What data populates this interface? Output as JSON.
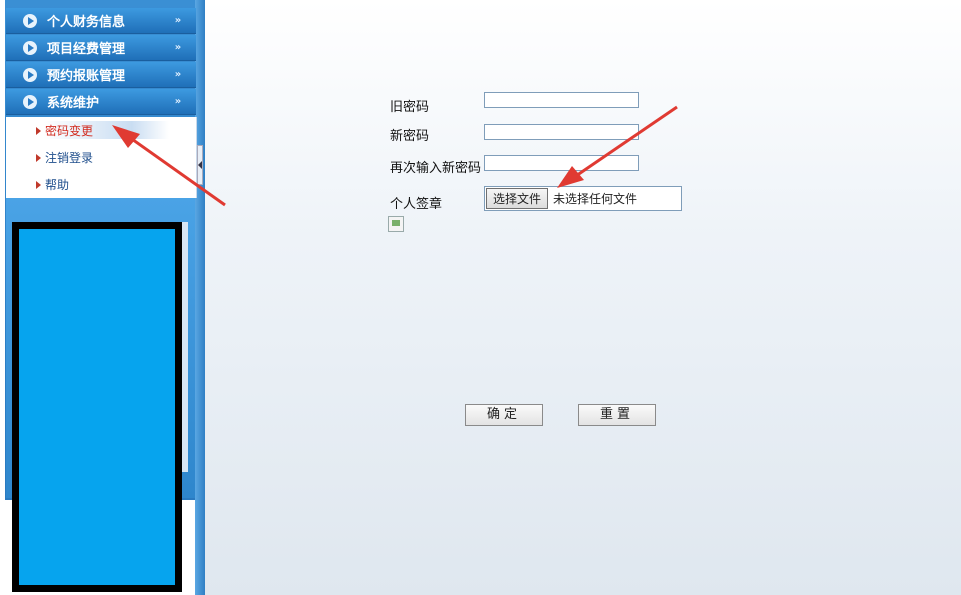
{
  "sidebar": {
    "menus": [
      {
        "label": "个人财务信息",
        "chevron": "»"
      },
      {
        "label": "项目经费管理",
        "chevron": "»"
      },
      {
        "label": "预约报账管理",
        "chevron": "»"
      },
      {
        "label": "系统维护",
        "chevron": "»"
      }
    ],
    "submenu": [
      {
        "label": "密码变更",
        "active": true
      },
      {
        "label": "注销登录",
        "active": false
      },
      {
        "label": "帮助",
        "active": false
      }
    ]
  },
  "form": {
    "old_password_label": "旧密码",
    "new_password_label": "新密码",
    "confirm_password_label": "再次输入新密码",
    "signature_label": "个人签章",
    "file_button_label": "选择文件",
    "file_status": "未选择任何文件",
    "confirm_button": "确定",
    "reset_button": "重置"
  },
  "colors": {
    "menu_accent": "#1f6fb8",
    "active_submenu": "#d22b1f",
    "annotation_arrow": "#e03a32",
    "redaction": "#06a4ee"
  }
}
